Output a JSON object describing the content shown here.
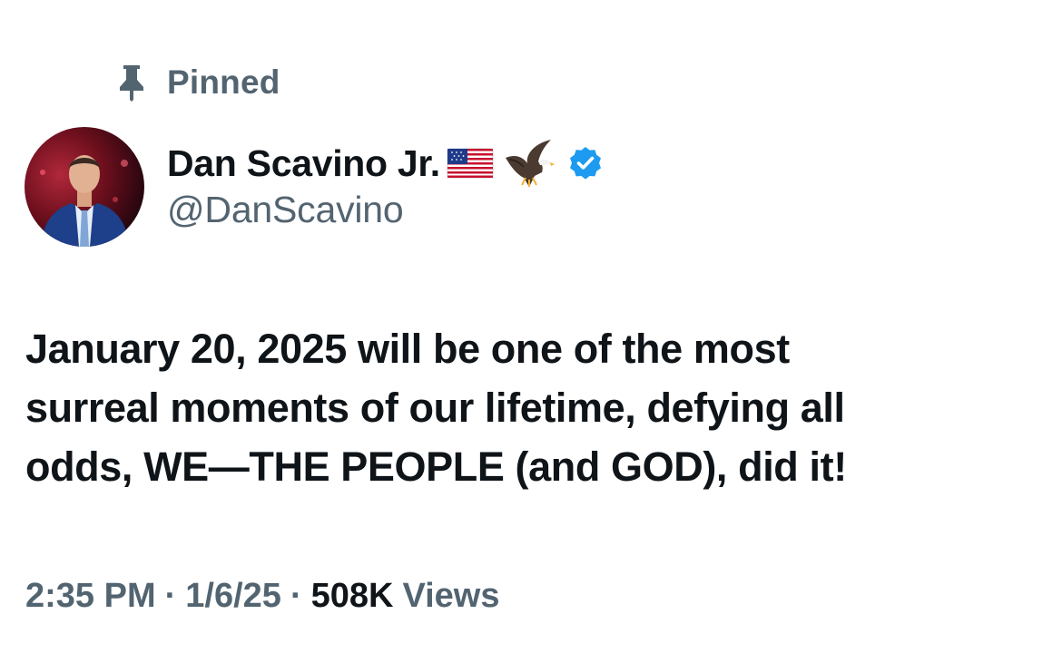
{
  "pinned": {
    "label": "Pinned",
    "icon": "pin-icon"
  },
  "author": {
    "display_name": "Dan Scavino Jr.",
    "handle": "@DanScavino",
    "name_emojis": [
      "us-flag-icon",
      "eagle-icon"
    ],
    "verified_icon": "verified-badge-icon",
    "verified_color": "#1d9bf0"
  },
  "tweet": {
    "text": "January 20, 2025 will be one of the most\nsurreal moments of our lifetime, defying all\nodds, WE—THE PEOPLE (and GOD), did it!"
  },
  "meta": {
    "time": "2:35 PM",
    "separator": "·",
    "date": "1/6/25",
    "views_count": "508K",
    "views_label": "Views"
  },
  "colors": {
    "primary_text": "#0f1419",
    "secondary_text": "#536471",
    "background": "#ffffff"
  }
}
